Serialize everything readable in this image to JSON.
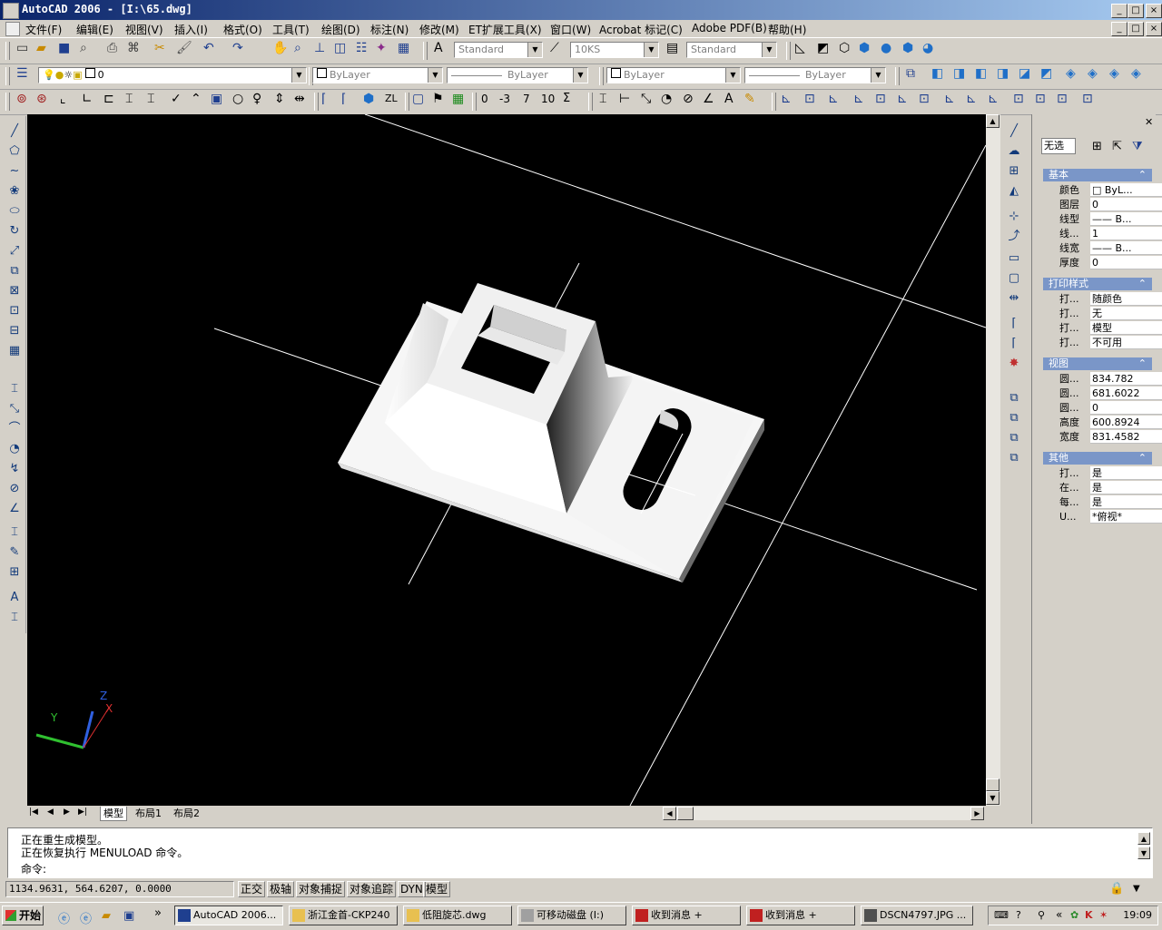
{
  "window": {
    "title": "AutoCAD 2006 - [I:\\65.dwg]",
    "min_label": "_",
    "max_label": "□",
    "close_label": "×"
  },
  "menu": [
    "文件(F)",
    "编辑(E)",
    "视图(V)",
    "插入(I)",
    "格式(O)",
    "工具(T)",
    "绘图(D)",
    "标注(N)",
    "修改(M)",
    "ET扩展工具(X)",
    "窗口(W)",
    "Acrobat 标记(C)",
    "Adobe PDF(B)",
    "帮助(H)"
  ],
  "toolbar": {
    "text_style": "Standard",
    "dim_style": "10KS",
    "table_style": "Standard",
    "layer": "0",
    "color": "ByLayer",
    "linetype": "ByLayer",
    "lineweight": "ByLayer",
    "plotstyle": "ByLayer",
    "dim_values": [
      "0",
      "-3",
      "7",
      "10",
      "Σ"
    ]
  },
  "tabs": [
    "模型",
    "布局1",
    "布局2"
  ],
  "properties": {
    "select_value": "无选",
    "sections": [
      {
        "title": "基本",
        "rows": [
          {
            "k": "颜色",
            "v": "□ ByL..."
          },
          {
            "k": "图层",
            "v": "0"
          },
          {
            "k": "线型",
            "v": "—— B..."
          },
          {
            "k": "线...",
            "v": "1"
          },
          {
            "k": "线宽",
            "v": "—— B..."
          },
          {
            "k": "厚度",
            "v": "0"
          }
        ]
      },
      {
        "title": "打印样式",
        "rows": [
          {
            "k": "打...",
            "v": "随颜色"
          },
          {
            "k": "打...",
            "v": "无"
          },
          {
            "k": "打...",
            "v": "模型"
          },
          {
            "k": "打...",
            "v": "不可用"
          }
        ]
      },
      {
        "title": "视图",
        "rows": [
          {
            "k": "圆...",
            "v": "834.782"
          },
          {
            "k": "圆...",
            "v": "681.6022"
          },
          {
            "k": "圆...",
            "v": "0"
          },
          {
            "k": "高度",
            "v": "600.8924"
          },
          {
            "k": "宽度",
            "v": "831.4582"
          }
        ]
      },
      {
        "title": "其他",
        "rows": [
          {
            "k": "打...",
            "v": "是"
          },
          {
            "k": "在...",
            "v": "是"
          },
          {
            "k": "每...",
            "v": "是"
          },
          {
            "k": "U...",
            "v": "*俯视*"
          }
        ]
      }
    ]
  },
  "command": {
    "lines": [
      "正在重生成模型。",
      "正在恢复执行 MENULOAD 命令。"
    ],
    "prompt": "命令:"
  },
  "ucs": {
    "x": "X",
    "y": "Y",
    "z": "Z"
  },
  "status": {
    "coords": "1134.9631, 564.6207, 0.0000",
    "buttons": [
      "正交",
      "极轴",
      "对象捕捉",
      "对象追踪",
      "DYN",
      "模型"
    ]
  },
  "taskbar": {
    "start": "开始",
    "expand": "»",
    "tasks": [
      "AutoCAD 2006...",
      "浙江金首-CKP240",
      "低阻旋芯.dwg",
      "可移动磁盘 (I:)",
      "收到消息 +",
      "收到消息 +",
      "DSCN4797.JPG ..."
    ],
    "tray_expand": "«",
    "clock": "19:09"
  },
  "colors": {
    "titlebar": "#0a246a",
    "viewport": "#000000",
    "section_header": "#7a96c8",
    "ucs_x": "#e03030",
    "ucs_y": "#30c030",
    "ucs_z": "#3060e0"
  }
}
